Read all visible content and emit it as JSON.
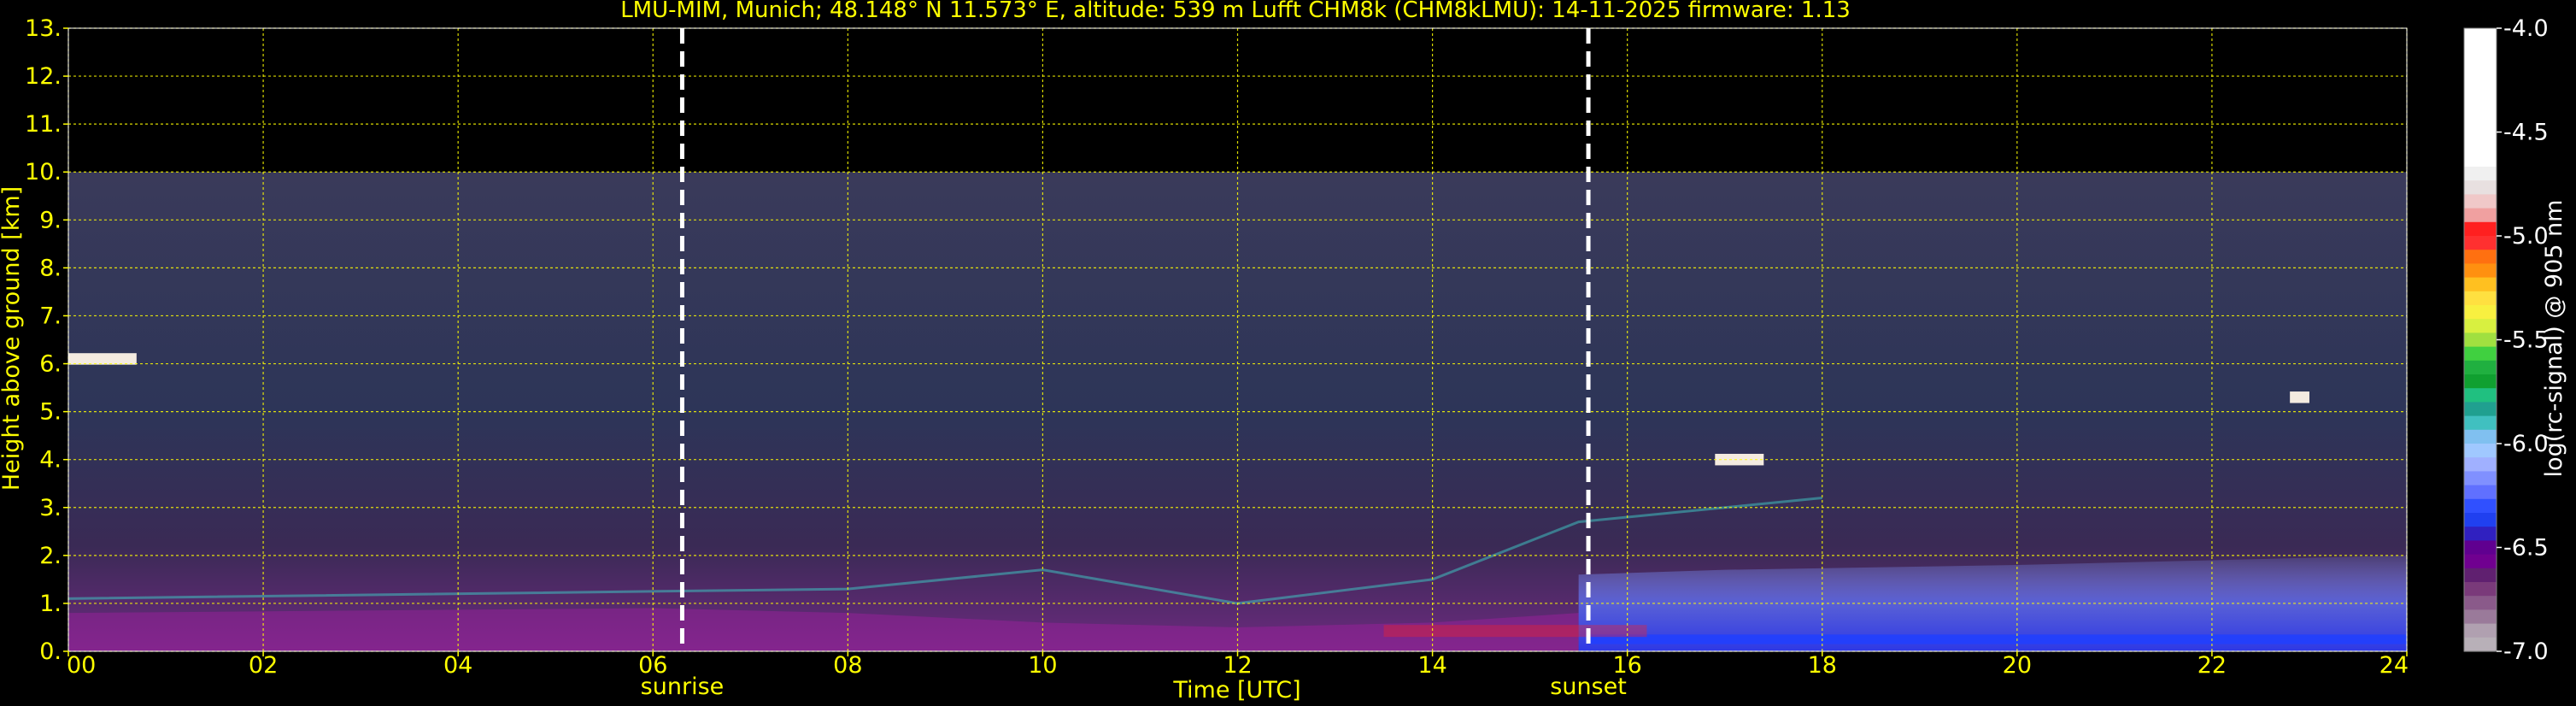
{
  "chart_data": {
    "type": "heatmap",
    "title": "LMU-MIM, Munich; 48.148° N 11.573° E, altitude: 539 m    Lufft CHM8k (CHM8kLMU): 14-11-2025    firmware: 1.13",
    "xlabel": "Time [UTC]",
    "ylabel": "Height above ground [km]",
    "colorbar_label": "log(rc-signal) @ 905 nm",
    "xlim": [
      0,
      24
    ],
    "ylim": [
      0,
      13
    ],
    "x_ticks": [
      "00",
      "02",
      "04",
      "06",
      "08",
      "10",
      "12",
      "14",
      "16",
      "18",
      "20",
      "22",
      "24"
    ],
    "y_ticks": [
      "0.",
      "1.",
      "2.",
      "3.",
      "4.",
      "5.",
      "6.",
      "7.",
      "8.",
      "9.",
      "10.",
      "11.",
      "12.",
      "13."
    ],
    "colorbar_range": [
      -7.0,
      -4.0
    ],
    "colorbar_ticks": [
      "-4.0",
      "-4.5",
      "-5.0",
      "-5.5",
      "-6.0",
      "-6.5",
      "-7.0"
    ],
    "grid": true,
    "data_top_km": 10,
    "markers": [
      {
        "label": "sunrise",
        "time_h": 6.3
      },
      {
        "label": "sunset",
        "time_h": 15.6
      }
    ],
    "features": [
      {
        "name": "cloud",
        "t_start": 0.0,
        "t_end": 0.7,
        "height_km": 6.1
      },
      {
        "name": "cloud",
        "t_start": 16.9,
        "t_end": 17.4,
        "height_km": 4.0
      },
      {
        "name": "cloud",
        "t_start": 22.8,
        "t_end": 23.0,
        "height_km": 5.3
      },
      {
        "name": "boundary-layer top",
        "points": [
          [
            0,
            1.1
          ],
          [
            8,
            1.3
          ],
          [
            10,
            1.7
          ],
          [
            12,
            1.0
          ],
          [
            14,
            1.5
          ],
          [
            15.5,
            2.7
          ],
          [
            18,
            3.2
          ]
        ]
      }
    ],
    "colors": {
      "text": "#ffff00",
      "grid": "#ffff00",
      "marker": "#ffffff",
      "background": "#000000"
    }
  }
}
